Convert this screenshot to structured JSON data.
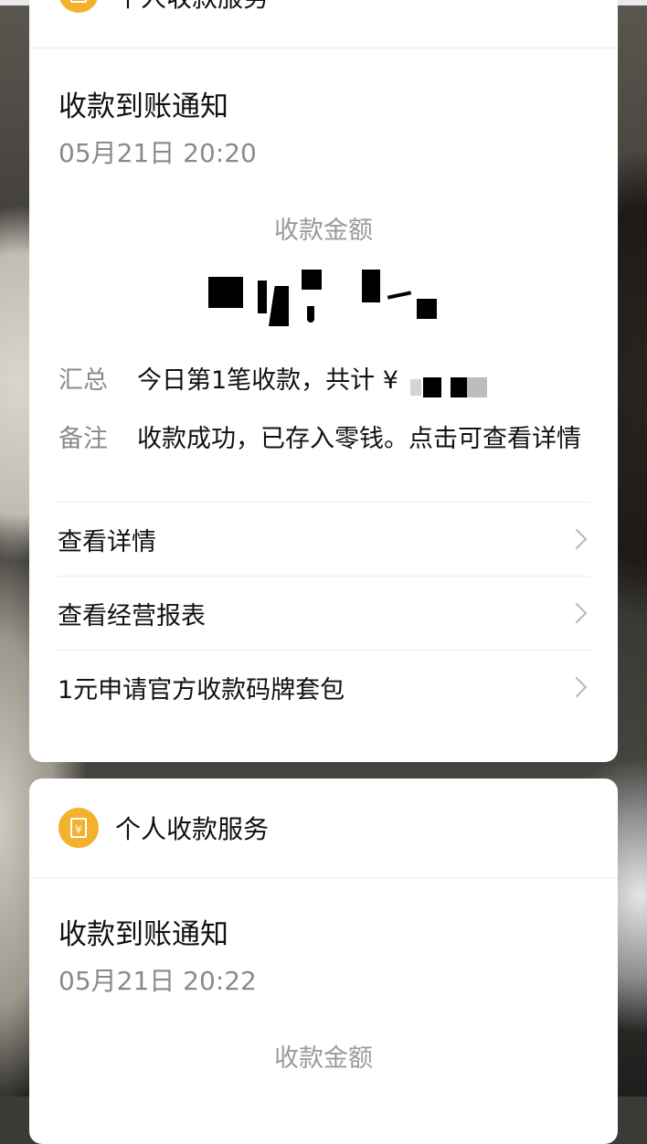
{
  "card1": {
    "service_name": "个人收款服务",
    "notice_title": "收款到账通知",
    "notice_time": "05月21日 20:20",
    "amount_label": "收款金额",
    "summary_key": "汇总",
    "summary_value": "今日第1笔收款，共计 ¥",
    "remark_key": "备注",
    "remark_value": "收款成功，已存入零钱。点击可查看详情",
    "links": [
      {
        "label": "查看详情"
      },
      {
        "label": "查看经营报表"
      },
      {
        "label": "1元申请官方收款码牌套包"
      }
    ]
  },
  "card2": {
    "service_name": "个人收款服务",
    "notice_title": "收款到账通知",
    "notice_time": "05月21日 20:22",
    "amount_label": "收款金额"
  },
  "colors": {
    "accent": "#f3b12d",
    "muted_text": "#8a8a8a",
    "primary_text": "#111111"
  },
  "icons": {
    "service": "ledger-yuan-icon",
    "link_arrow": "chevron-right-icon"
  }
}
